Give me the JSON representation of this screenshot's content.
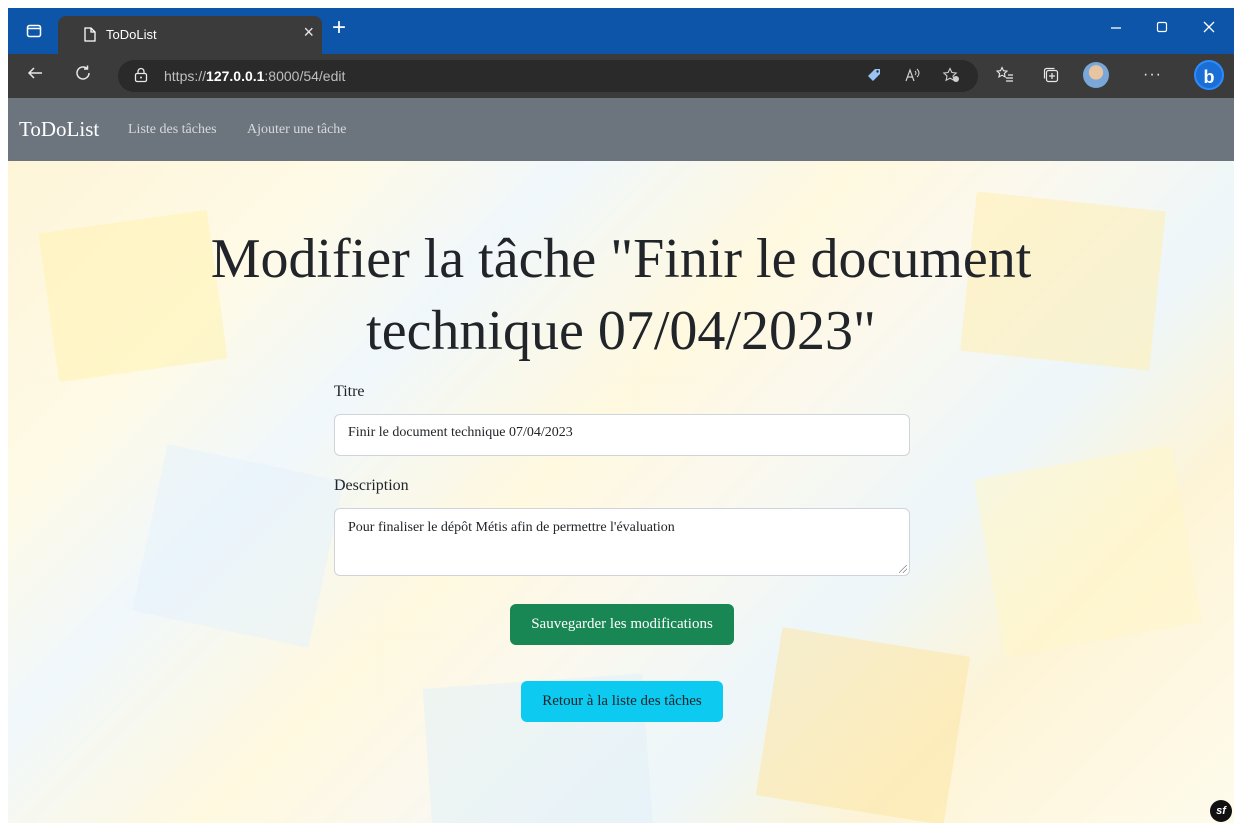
{
  "browser": {
    "tab_title": "ToDoList",
    "tab_close": "×",
    "new_tab": "+",
    "url_prefix": "https://",
    "url_host": "127.0.0.1",
    "url_rest": ":8000/54/edit",
    "more_menu": "···",
    "accent_color": "#0d55a9"
  },
  "navbar": {
    "brand": "ToDoList",
    "links": [
      "Liste des tâches",
      "Ajouter une tâche"
    ],
    "background": "#6c757d"
  },
  "page": {
    "heading_line1": "Modifier la tâche \"Finir le document",
    "heading_line2": "technique 07/04/2023\""
  },
  "form": {
    "title_label": "Titre",
    "title_value": "Finir le document technique 07/04/2023",
    "description_label": "Description",
    "description_value": "Pour finaliser le dépôt Métis afin de permettre l'évaluation",
    "save_button": "Sauvegarder les modifications",
    "save_color": "#198754",
    "back_button": "Retour à la liste des tâches",
    "back_color": "#0dcaf0"
  },
  "footer": {
    "symfony_badge": "sf"
  }
}
